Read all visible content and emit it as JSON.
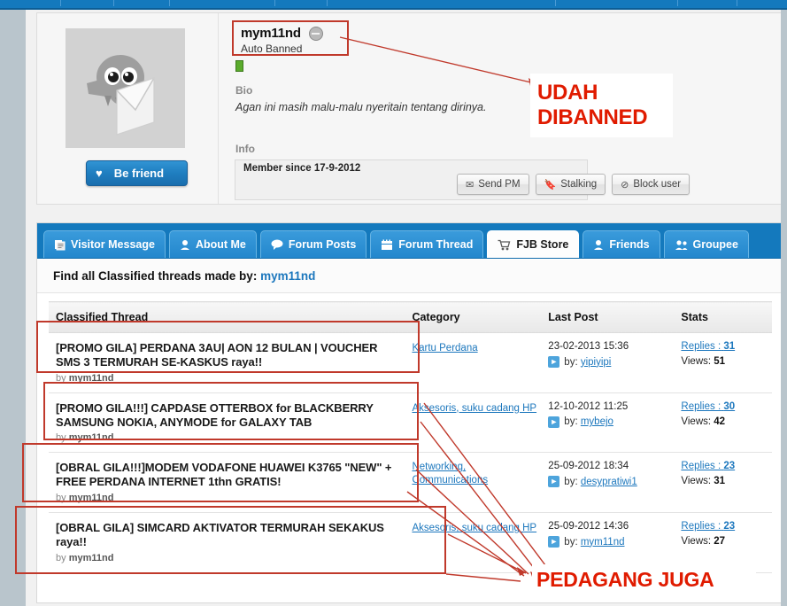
{
  "profile": {
    "avatar_alt": "default-kaskus-avatar",
    "be_friend_label": "Be friend",
    "username": "mym11nd",
    "status": "Auto Banned",
    "bio_heading": "Bio",
    "bio_text": "Agan ini masih malu-malu nyeritain tentang dirinya.",
    "info_heading": "Info",
    "member_since": "Member since 17-9-2012",
    "buttons": [
      {
        "label": "Send PM",
        "icon": "envelope-icon"
      },
      {
        "label": "Stalking",
        "icon": "bookmark-icon"
      },
      {
        "label": "Block user",
        "icon": "block-icon"
      }
    ]
  },
  "tabs": [
    {
      "label": "Visitor Message",
      "icon": "pages-icon",
      "active": false
    },
    {
      "label": "About Me",
      "icon": "person-icon",
      "active": false
    },
    {
      "label": "Forum Posts",
      "icon": "speech-bubble-icon",
      "active": false
    },
    {
      "label": "Forum Thread",
      "icon": "calendar-icon",
      "active": false
    },
    {
      "label": "FJB Store",
      "icon": "shopping-cart-icon",
      "active": true
    },
    {
      "label": "Friends",
      "icon": "person-icon",
      "active": false
    },
    {
      "label": "Groupee",
      "icon": "group-icon",
      "active": false
    }
  ],
  "find_line": {
    "prefix": "Find all Classified threads made by:",
    "username": "mym11nd"
  },
  "table": {
    "headers": [
      "Classified Thread",
      "Category",
      "Last Post",
      "Stats"
    ],
    "rows": [
      {
        "title": "[PROMO GILA] PERDANA 3AU| AON 12 BULAN | VOUCHER SMS 3 TERMURAH SE-KASKUS raya!!",
        "by_prefix": "by",
        "by": "mym11nd",
        "category": "Kartu Perdana",
        "last_post_date": "23-02-2013 15:36",
        "last_post_by_prefix": "by:",
        "last_post_by": "yipiyipi",
        "replies_label": "Replies :",
        "replies": "31",
        "views_label": "Views:",
        "views": "51"
      },
      {
        "title": "[PROMO GILA!!!] CAPDASE OTTERBOX for BLACKBERRY SAMSUNG NOKIA, ANYMODE for GALAXY TAB",
        "by_prefix": "by",
        "by": "mym11nd",
        "category": "Aksesoris, suku cadang HP",
        "last_post_date": "12-10-2012 11:25",
        "last_post_by_prefix": "by:",
        "last_post_by": "mybejo",
        "replies_label": "Replies :",
        "replies": "30",
        "views_label": "Views:",
        "views": "42"
      },
      {
        "title": "[OBRAL GILA!!!]MODEM VODAFONE HUAWEI K3765 \"NEW\" + FREE PERDANA INTERNET 1thn GRATIS!",
        "by_prefix": "by",
        "by": "mym11nd",
        "category": "Networking, Communications",
        "last_post_date": "25-09-2012 18:34",
        "last_post_by_prefix": "by:",
        "last_post_by": "desypratiwi1",
        "replies_label": "Replies :",
        "replies": "23",
        "views_label": "Views:",
        "views": "31"
      },
      {
        "title": "[OBRAL GILA] SIMCARD AKTIVATOR TERMURAH SEKAKUS raya!!",
        "by_prefix": "by",
        "by": "mym11nd",
        "category": "Aksesoris, suku cadang HP",
        "last_post_date": "25-09-2012 14:36",
        "last_post_by_prefix": "by:",
        "last_post_by": "mym11nd",
        "replies_label": "Replies :",
        "replies": "23",
        "views_label": "Views:",
        "views": "27"
      }
    ]
  },
  "annotations": {
    "banned_note": "UDAH\nDIBANNED",
    "banned_note_line1": "UDAH",
    "banned_note_line2": "DIBANNED",
    "seller_note": "PEDAGANG JUGA",
    "color": "#e01b00",
    "box_color": "#c0392b"
  }
}
